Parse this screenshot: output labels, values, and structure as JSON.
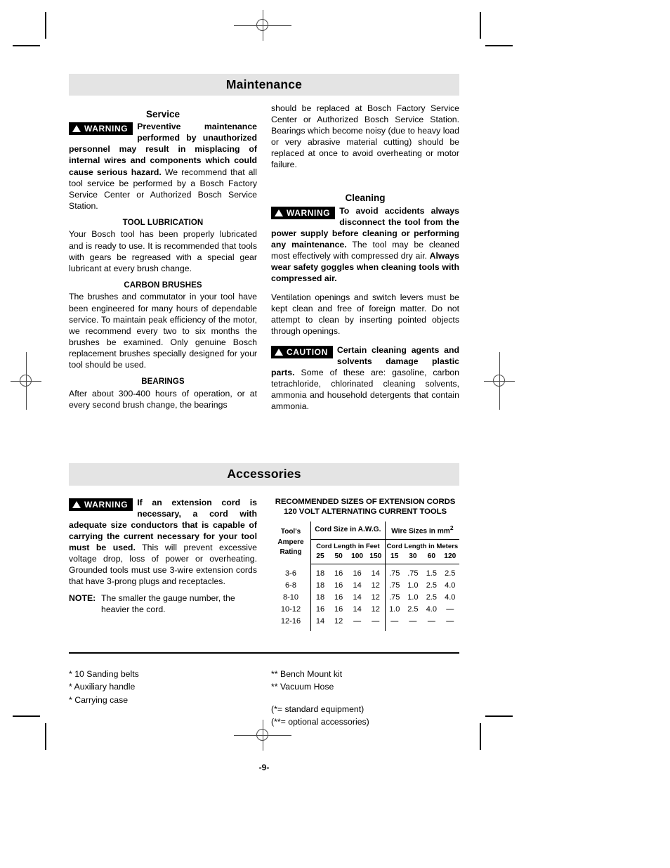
{
  "sections": {
    "maintenance": {
      "band_title": "Maintenance",
      "service": {
        "heading": "Service",
        "warning_badge": "WARNING",
        "warning_bold": "Preventive maintenance performed by unauthorized personnel may result in misplacing of internal wires and components which could cause serious hazard.",
        "warning_rest": " We recommend that all tool service be performed by a Bosch Factory Service Center or Authorized Bosch Service Station."
      },
      "tool_lubrication": {
        "heading": "TOOL LUBRICATION",
        "body": "Your Bosch tool has been properly lubricated and is ready to use. It is recommended that tools with gears be regreased with a special gear lubricant at every brush change."
      },
      "carbon_brushes": {
        "heading": "CARBON BRUSHES",
        "body": "The brushes and commutator in your tool have been engineered for many hours of dependable service. To maintain peak efficiency of the motor, we recommend every two to six months the brushes be examined. Only genuine Bosch replacement brushes specially designed for your tool should be used."
      },
      "bearings": {
        "heading": "BEARINGS",
        "body": "After about 300-400 hours of operation, or at every second brush change, the bearings"
      },
      "bearings_continued": "should be replaced at Bosch Factory Service Center or Authorized Bosch Service Station. Bearings which become noisy (due to heavy load or very abrasive material cutting) should be replaced at once to avoid overheating or motor failure.",
      "cleaning": {
        "heading": "Cleaning",
        "warning_badge": "WARNING",
        "warning_bold_1": "To avoid accidents always disconnect the tool from the power supply before cleaning or performing any maintenance.",
        "warning_rest_1": " The tool may be cleaned most effectively with compressed dry air. ",
        "warning_bold_2": "Always wear safety goggles when cleaning tools with compressed air.",
        "para_2": "Ventilation openings and switch levers must be kept clean and free of foreign matter. Do not attempt to clean by inserting pointed objects through openings.",
        "caution_badge": "CAUTION",
        "caution_bold": "Certain cleaning agents and solvents damage plastic parts.",
        "caution_rest": " Some of these are: gasoline, carbon tetrachloride, chlorinated cleaning solvents, ammonia and household detergents that contain ammonia."
      }
    },
    "accessories": {
      "band_title": "Accessories",
      "warning_badge": "WARNING",
      "warning_bold": "If an extension cord is necessary, a cord with adequate size conductors that is capable of carrying the current necessary for your tool must be used.",
      "warning_rest": " This will prevent excessive voltage drop, loss of power or overheating.  Grounded tools must use 3-wire extension cords that have 3-prong plugs and receptacles.",
      "note_label": "NOTE:",
      "note_text": "The smaller the gauge number, the heavier the cord.",
      "standard_items": [
        "* 10 Sanding belts",
        "* Auxiliary handle",
        "* Carrying case"
      ],
      "optional_items": [
        "** Bench Mount kit",
        "** Vacuum Hose"
      ],
      "legend": [
        "(*= standard equipment)",
        "(**= optional accessories)"
      ]
    }
  },
  "cord_table": {
    "type": "table",
    "title_line_1": "RECOMMENDED SIZES OF EXTENSION CORDS",
    "title_line_2": "120 VOLT ALTERNATING CURRENT TOOLS",
    "row_header": "Tool's Ampere Rating",
    "row_header_lines": [
      "Tool's",
      "Ampere",
      "Rating"
    ],
    "group_awg": "Cord Size in A.W.G.",
    "group_mm": "Wire Sizes in mm",
    "group_mm_sup": "2",
    "sub_feet": "Cord Length in Feet",
    "sub_meters": "Cord Length in Meters",
    "feet_cols": [
      "25",
      "50",
      "100",
      "150"
    ],
    "meter_cols": [
      "15",
      "30",
      "60",
      "120"
    ],
    "rows": [
      {
        "rating": "3-6",
        "awg": [
          "18",
          "16",
          "16",
          "14"
        ],
        "mm2": [
          ".75",
          ".75",
          "1.5",
          "2.5"
        ]
      },
      {
        "rating": "6-8",
        "awg": [
          "18",
          "16",
          "14",
          "12"
        ],
        "mm2": [
          ".75",
          "1.0",
          "2.5",
          "4.0"
        ]
      },
      {
        "rating": "8-10",
        "awg": [
          "18",
          "16",
          "14",
          "12"
        ],
        "mm2": [
          ".75",
          "1.0",
          "2.5",
          "4.0"
        ]
      },
      {
        "rating": "10-12",
        "awg": [
          "16",
          "16",
          "14",
          "12"
        ],
        "mm2": [
          "1.0",
          "2.5",
          "4.0",
          "—"
        ]
      },
      {
        "rating": "12-16",
        "awg": [
          "14",
          "12",
          "—",
          "—"
        ],
        "mm2": [
          "—",
          "—",
          "—",
          "—"
        ]
      }
    ]
  },
  "page_number": "-9-",
  "colors": {
    "band_background": "#e4e4e4",
    "text": "#000000",
    "badge_background": "#000000",
    "registration_mark": "#4a4a4a"
  }
}
